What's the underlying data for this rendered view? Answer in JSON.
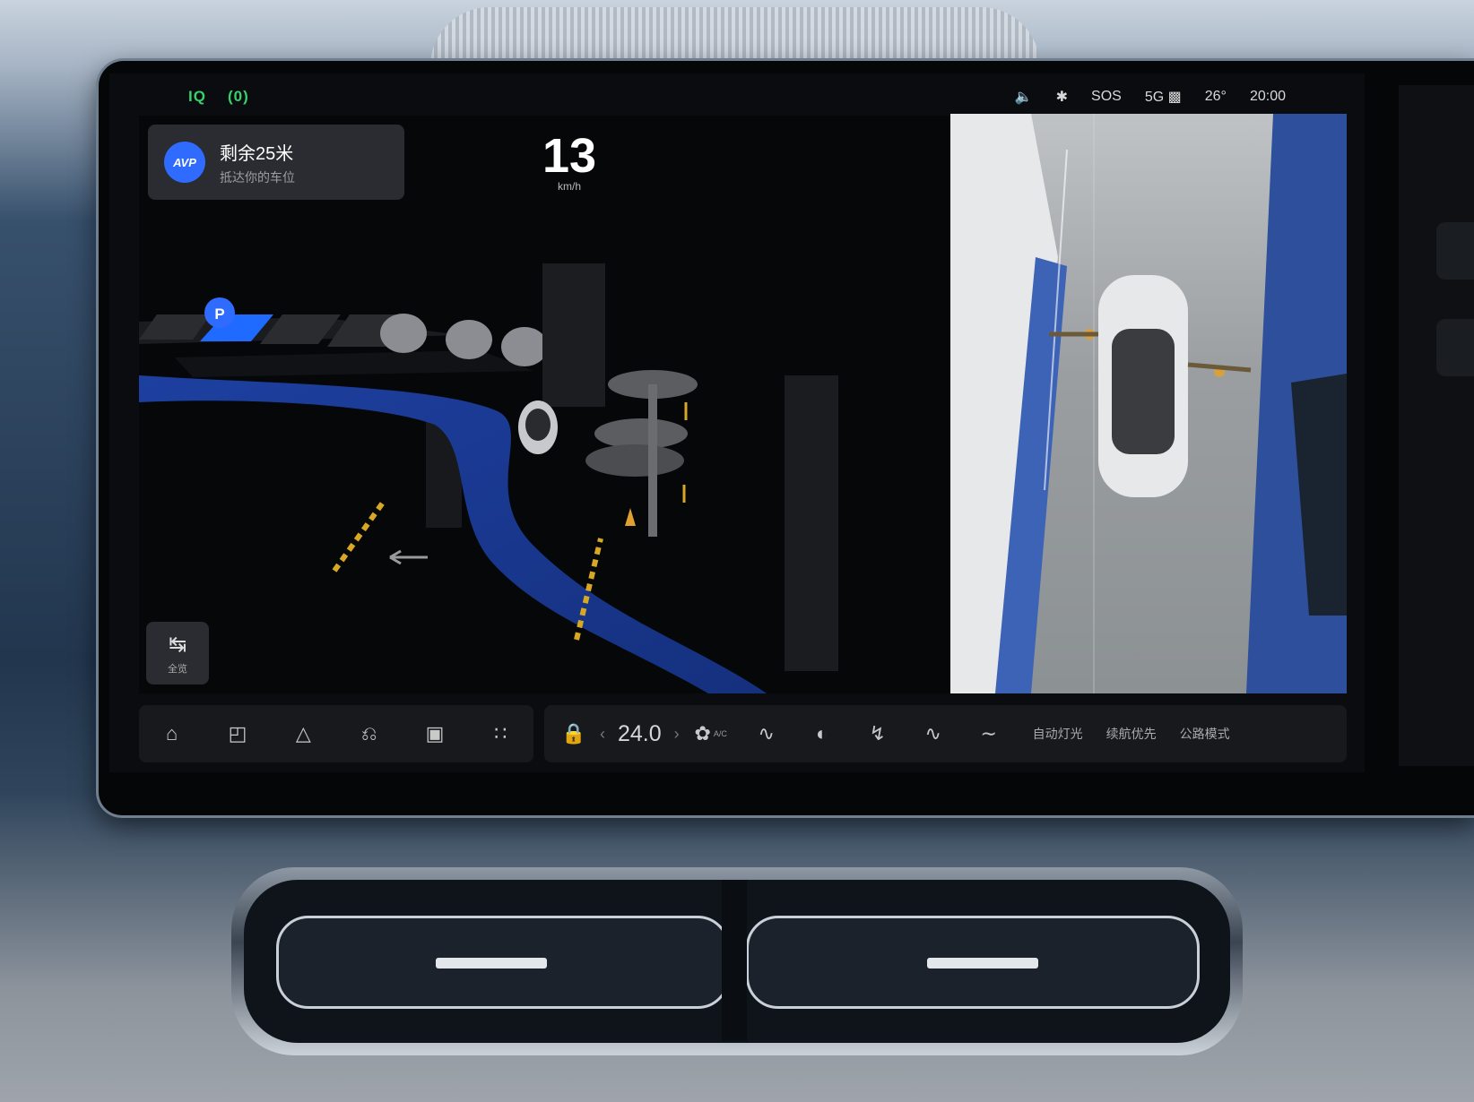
{
  "status_bar": {
    "left_indicators": [
      "IQ",
      "(0)"
    ],
    "volume": "volume-icon",
    "bluetooth": "bluetooth-icon",
    "sos": "SOS",
    "signal": "5G",
    "temperature": "26°",
    "time": "20:00"
  },
  "navigation": {
    "title": "剩余25米",
    "subtitle": "抵达你的车位",
    "badge": "AVP",
    "speed": "13",
    "speed_unit": "km/h",
    "parking_marker": "P",
    "overview_label": "全览"
  },
  "climate": {
    "temperature": "24.0",
    "ac_label": "A/C"
  },
  "dock_text_buttons": [
    "自动灯光",
    "续航优先",
    "公路模式"
  ],
  "colors": {
    "accent_blue": "#2f6bff",
    "status_green": "#38d16b",
    "route_blue": "#1c3f9c"
  }
}
